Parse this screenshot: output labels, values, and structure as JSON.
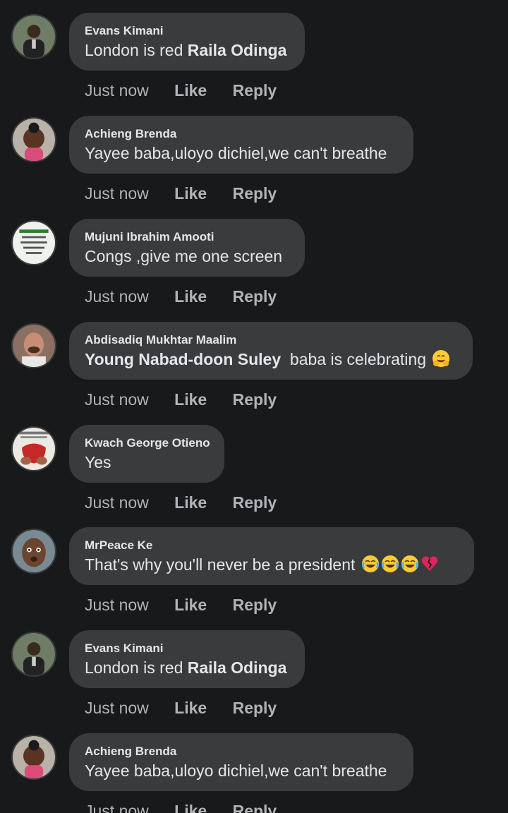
{
  "comments": [
    {
      "author": "Evans Kimani",
      "text": "London is red ",
      "tag": "Raila Odinga",
      "time": "Just now",
      "like": "Like",
      "reply": "Reply",
      "avatar_color": "#5c6a4f"
    },
    {
      "author": "Achieng Brenda",
      "text": "Yayee baba,uloyo dichiel,we can't breathe",
      "time": "Just now",
      "like": "Like",
      "reply": "Reply",
      "avatar_color": "#7a4b3c"
    },
    {
      "author": "Mujuni Ibrahim Amooti",
      "text": "Congs ,give me one screen",
      "time": "Just now",
      "like": "Like",
      "reply": "Reply",
      "avatar_color": "#e8ece6"
    },
    {
      "author": "Abdisadiq Mukhtar Maalim",
      "tag": "Young Nabad-doon Suley",
      "text": "  baba is celebrating ",
      "emojis": [
        "hugging-face-icon"
      ],
      "time": "Just now",
      "like": "Like",
      "reply": "Reply",
      "avatar_color": "#9a6a55"
    },
    {
      "author": "Kwach George Otieno",
      "text": "Yes",
      "time": "Just now",
      "like": "Like",
      "reply": "Reply",
      "avatar_color": "#c44b3f"
    },
    {
      "author": "MrPeace Ke",
      "text": "That's why you'll never be a president ",
      "emojis": [
        "tears-of-joy-icon",
        "tears-of-joy-icon",
        "tears-of-joy-icon",
        "broken-heart-icon"
      ],
      "time": "Just now",
      "like": "Like",
      "reply": "Reply",
      "avatar_color": "#6a4a35"
    },
    {
      "author": "Evans Kimani",
      "text": "London is red ",
      "tag": "Raila Odinga",
      "time": "Just now",
      "like": "Like",
      "reply": "Reply",
      "avatar_color": "#5c6a4f"
    },
    {
      "author": "Achieng Brenda",
      "text": "Yayee baba,uloyo dichiel,we can't breathe",
      "time": "Just now",
      "like": "Like",
      "reply": "Reply",
      "avatar_color": "#7a4b3c"
    }
  ]
}
